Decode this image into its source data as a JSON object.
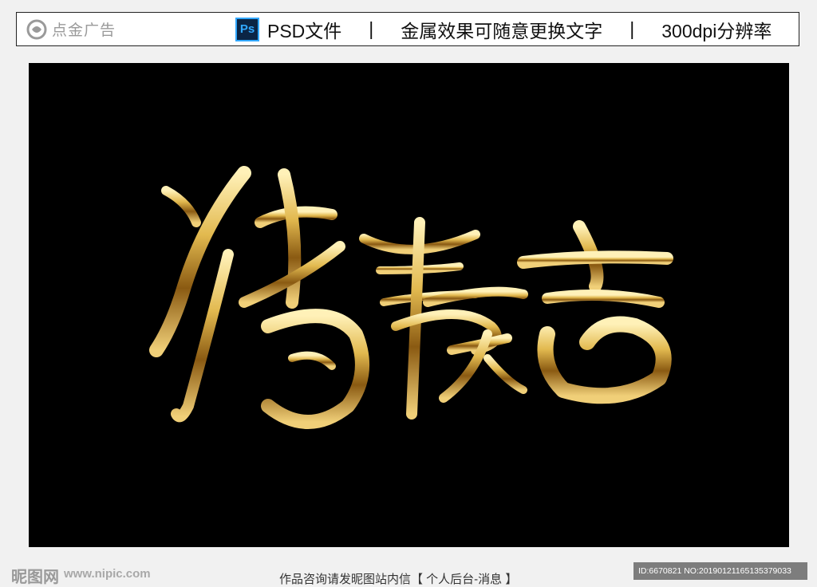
{
  "header": {
    "brand_text": "点金广告",
    "ps_label": "Ps",
    "file_type": "PSD文件",
    "sep1": "|",
    "feature": "金属效果可随意更换文字",
    "sep2": "|",
    "resolution": "300dpi分辨率"
  },
  "artwork": {
    "calligraphy_text": "精事大吉",
    "gold_color": "#d9b24a"
  },
  "footer": {
    "watermark_logo": "昵图网",
    "watermark_url": "www.nipic.com",
    "notice": "作品咨询请发昵图站内信【 个人后台-消息 】",
    "id_info": "ID:6670821 NO:20190121165135379033"
  }
}
